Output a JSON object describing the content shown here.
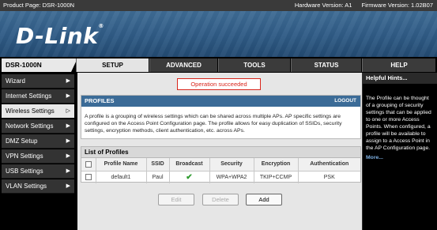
{
  "topbar": {
    "product": "Product Page: DSR-1000N",
    "hardware": "Hardware Version: A1",
    "firmware": "Firmware Version: 1.02B07"
  },
  "brand": {
    "logo": "D-Link",
    "reg": "®"
  },
  "model": "DSR-1000N",
  "tabs": [
    {
      "label": "SETUP",
      "active": true
    },
    {
      "label": "ADVANCED",
      "active": false
    },
    {
      "label": "TOOLS",
      "active": false
    },
    {
      "label": "STATUS",
      "active": false
    },
    {
      "label": "HELP",
      "active": false
    }
  ],
  "sidebar": {
    "items": [
      {
        "label": "Wizard",
        "arrow": "▶"
      },
      {
        "label": "Internet Settings",
        "arrow": "▶"
      },
      {
        "label": "Wireless Settings",
        "arrow": "▷"
      },
      {
        "label": "Network Settings",
        "arrow": "▶"
      },
      {
        "label": "DMZ Setup",
        "arrow": "▶"
      },
      {
        "label": "VPN Settings",
        "arrow": "▶"
      },
      {
        "label": "USB Settings",
        "arrow": "▶"
      },
      {
        "label": "VLAN Settings",
        "arrow": "▶"
      }
    ]
  },
  "status_message": "Operation succeeded",
  "profiles": {
    "title": "PROFILES",
    "logout": "LOGOUT",
    "description": "A profile is a grouping of wireless settings which can be shared across multiple APs. AP specific settings are configured on the Access Point Configuration page. The profile allows for easy duplication of SSIDs, security settings, encryption methods, client authentication, etc. across APs."
  },
  "list": {
    "title": "List of Profiles",
    "columns": [
      "Profile Name",
      "SSID",
      "Broadcast",
      "Security",
      "Encryption",
      "Authentication"
    ],
    "rows": [
      {
        "profile_name": "default1",
        "ssid": "Paul",
        "broadcast": "✔",
        "security": "WPA+WPA2",
        "encryption": "TKIP+CCMP",
        "authentication": "PSK"
      }
    ]
  },
  "buttons": {
    "edit": "Edit",
    "delete": "Delete",
    "add": "Add"
  },
  "hints": {
    "title": "Helpful Hints...",
    "body": "The Profile can be thought of a grouping of security settings that can be applied to one or more Access Points. When configured, a profile will be available to assign to a Access Point in the AP Configuration page.",
    "more": "More..."
  },
  "colors": {
    "header_blue": "#3b6b97",
    "status_red": "#d9261c",
    "check_green": "#2e9b2e"
  }
}
